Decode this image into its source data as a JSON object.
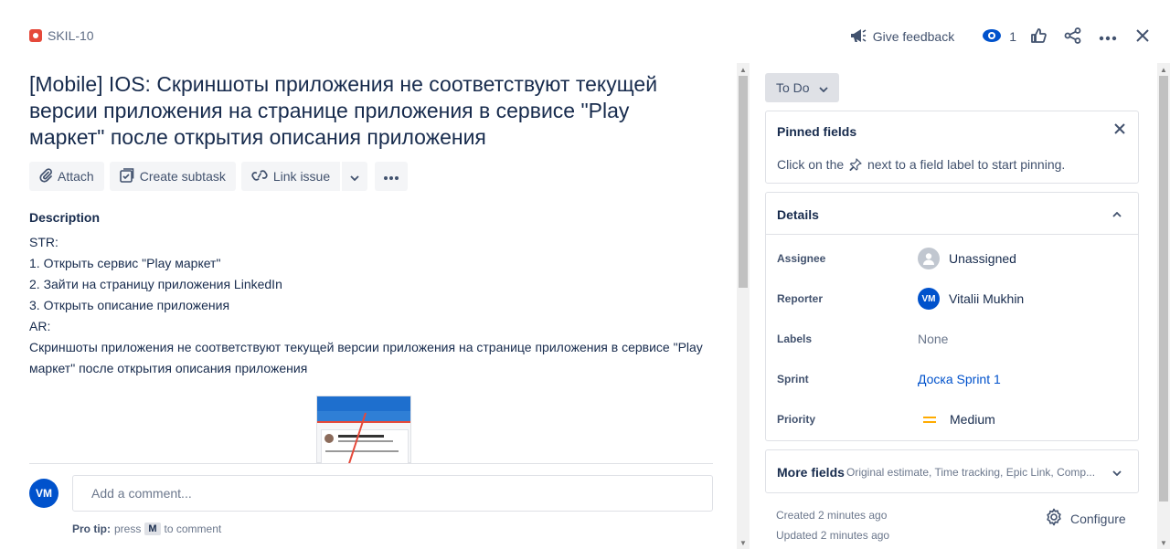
{
  "header": {
    "issue_key": "SKIL-10",
    "feedback_label": "Give feedback",
    "watch_count": "1"
  },
  "issue": {
    "title": "[Mobile] IOS: Скриншоты приложения не соответствуют текущей версии приложения на странице приложения в сервисе \"Play маркет\" после открытия описания приложения",
    "toolbar": {
      "attach": "Attach",
      "create_subtask": "Create subtask",
      "link_issue": "Link issue"
    },
    "description_label": "Description",
    "description_lines": [
      "STR:",
      "1. Открыть сервис \"Play маркет\"",
      "2. Зайти на страницу приложения LinkedIn",
      "3. Открыть описание приложения",
      "AR:",
      "Скриншоты приложения не соответствуют текущей версии приложения на странице приложения в сервисе \"Play маркет\" после открытия описания приложения"
    ]
  },
  "comment": {
    "avatar_initials": "VM",
    "placeholder": "Add a comment...",
    "pro_tip_label": "Pro tip:",
    "pro_tip_pre": "press",
    "pro_tip_key": "M",
    "pro_tip_post": "to comment"
  },
  "sidebar": {
    "status": "To Do",
    "pinned": {
      "title": "Pinned fields",
      "hint_pre": "Click on the",
      "hint_post": "next to a field label to start pinning."
    },
    "details": {
      "title": "Details",
      "fields": [
        {
          "label": "Assignee",
          "value": "Unassigned"
        },
        {
          "label": "Reporter",
          "value": "Vitalii Mukhin",
          "initials": "VM"
        },
        {
          "label": "Labels",
          "value": "None"
        },
        {
          "label": "Sprint",
          "value": "Доска Sprint 1"
        },
        {
          "label": "Priority",
          "value": "Medium"
        }
      ]
    },
    "more_fields": {
      "title": "More fields",
      "summary": "Original estimate, Time tracking, Epic Link, Comp..."
    },
    "created": "Created 2 minutes ago",
    "updated": "Updated 2 minutes ago",
    "configure": "Configure"
  },
  "colors": {
    "accent": "#0052cc",
    "bug": "#e5493a",
    "priority_medium": "#ffab00"
  }
}
